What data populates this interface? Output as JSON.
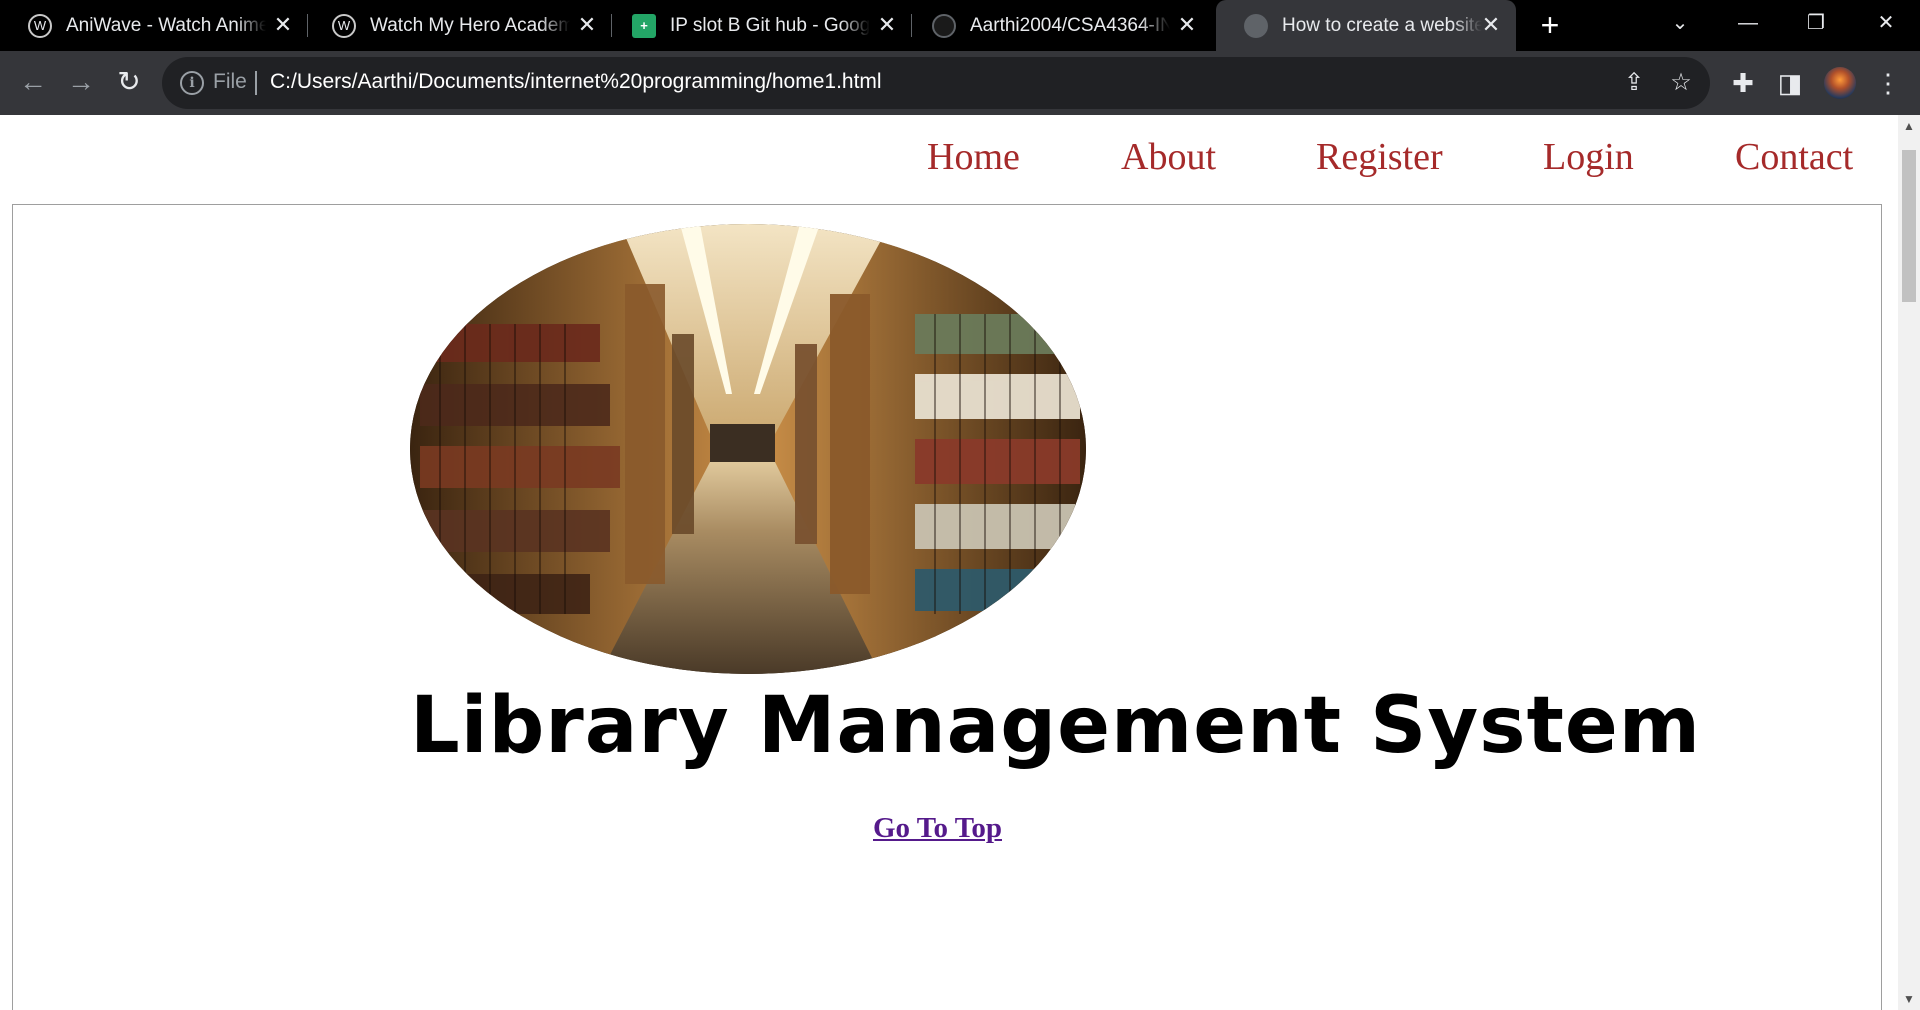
{
  "browser": {
    "tabs": [
      {
        "title": "AniWave - Watch Anime Online",
        "favicon": "aniwave-logo-icon",
        "active": false
      },
      {
        "title": "Watch My Hero Academia",
        "favicon": "aniwave-logo-icon",
        "active": false
      },
      {
        "title": "IP slot B Git hub - Google Sheets",
        "favicon": "google-sheets-icon",
        "active": false
      },
      {
        "title": "Aarthi2004/CSA4364-INTERNET",
        "favicon": "github-icon",
        "active": false
      },
      {
        "title": "How to create a website",
        "favicon": "globe-icon",
        "active": true
      }
    ],
    "new_tab_icon": "+",
    "address_bar": {
      "scheme_label": "File",
      "url": "C:/Users/Aarthi/Documents/internet%20programming/home1.html"
    }
  },
  "page": {
    "nav": {
      "items": [
        "Home",
        "About",
        "Register",
        "Login",
        "Contact"
      ],
      "link_color": "#a52a2a"
    },
    "hero_image": {
      "icon": "library-bookshelves-image"
    },
    "title": "Library Management System",
    "go_top_link": "Go To Top",
    "visited_link_color": "#551a8b"
  }
}
